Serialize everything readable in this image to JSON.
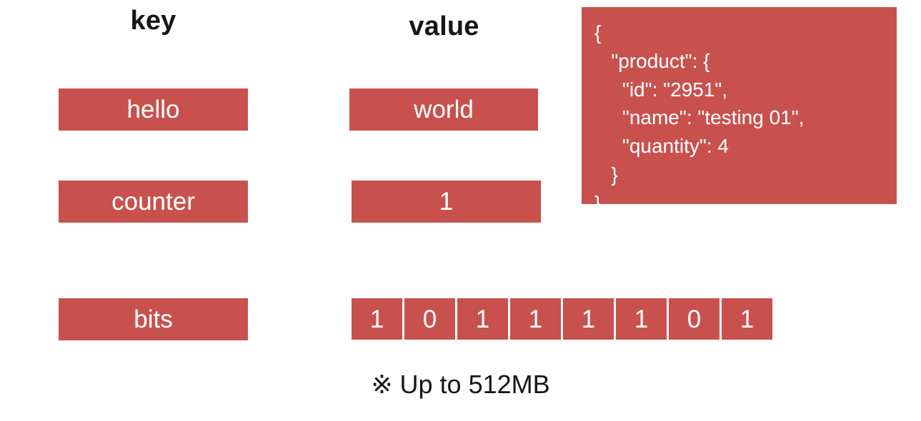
{
  "slide": {
    "background_color": "#ffffff",
    "accent_color": "#c8514d",
    "chip_text_color": "#ffffff",
    "heading_text_color": "#161616"
  },
  "headings": {
    "key": "key",
    "value": "value"
  },
  "rows": [
    {
      "key": "hello",
      "value": "world"
    },
    {
      "key": "counter",
      "value": "1"
    },
    {
      "key": "bits",
      "value": "10111101"
    }
  ],
  "bit_array": {
    "bits": [
      "1",
      "0",
      "1",
      "1",
      "1",
      "1",
      "0",
      "1"
    ],
    "count": 8
  },
  "json_panel": {
    "text": "{\n   \"product\": {\n     \"id\": \"2951\",\n     \"name\": \"testing 01\",\n     \"quantity\": 4\n   }\n}",
    "product": {
      "id": "2951",
      "name": "testing 01",
      "quantity": "4"
    }
  },
  "footnote": {
    "mark": "※",
    "text": " Up to 512MB",
    "full": "※ Up to 512MB",
    "limit": "512MB"
  }
}
